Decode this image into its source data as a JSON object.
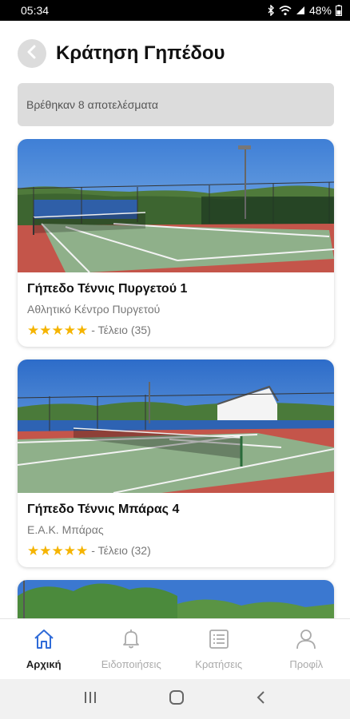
{
  "status_bar": {
    "time": "05:34",
    "battery": "48%",
    "icons": [
      "bluetooth-icon",
      "wifi-icon",
      "signal-icon",
      "battery-icon"
    ]
  },
  "header": {
    "title": "Κράτηση Γηπέδου",
    "back_icon": "chevron-left-icon"
  },
  "results": {
    "text": "Βρέθηκαν 8 αποτελέσματα"
  },
  "courts": [
    {
      "name": "Γήπεδο Τέννις Πυργετού 1",
      "venue": "Αθλητικό Κέντρο Πυργετού",
      "stars": 5,
      "rating_label": "- Τέλειο (35)"
    },
    {
      "name": "Γήπεδο Τέννις Μπάρας 4",
      "venue": "Ε.Α.Κ. Μπάρας",
      "stars": 5,
      "rating_label": "- Τέλειο (32)"
    }
  ],
  "nav": {
    "items": [
      {
        "label": "Αρχική",
        "icon": "home-icon",
        "active": true
      },
      {
        "label": "Ειδοποιήσεις",
        "icon": "bell-icon",
        "active": false
      },
      {
        "label": "Κρατήσεις",
        "icon": "list-icon",
        "active": false
      },
      {
        "label": "Προφίλ",
        "icon": "user-icon",
        "active": false
      }
    ]
  },
  "colors": {
    "star": "#f5b400",
    "accent": "#2f6bd8",
    "court_red": "#c4554a",
    "court_green": "#8fb08a"
  }
}
